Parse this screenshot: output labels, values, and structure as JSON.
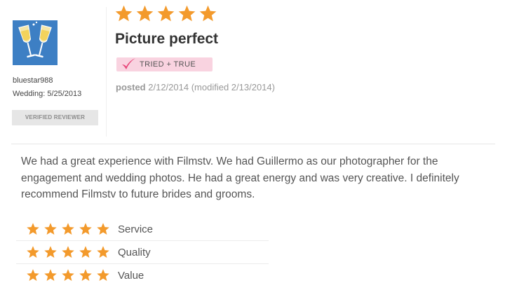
{
  "colors": {
    "star": "#f39a2c",
    "badge_pink": "#f9d3e0",
    "check_pink": "#e8467a",
    "avatar_blue": "#3d7fc4"
  },
  "reviewer": {
    "avatar_icon": "champagne-glasses-icon",
    "username": "bluestar988",
    "wedding_label": "Wedding:",
    "wedding_date": "5/25/2013",
    "verified_badge": "VERIFIED REVIEWER"
  },
  "review": {
    "overall_rating": 5,
    "overall_max": 5,
    "title": "Picture perfect",
    "badge_icon": "checkmark-icon",
    "badge_text": "TRIED + TRUE",
    "posted_label": "posted",
    "posted_date": "2/12/2014",
    "modified_text": "(modified 2/13/2014)",
    "body": "We had a great experience with Filmstv. We had Guillermo as our photographer for the engagement and wedding photos. He had a great energy and was very creative. I definitely recommend Filmstv to future brides and grooms."
  },
  "ratings": [
    {
      "label": "Service",
      "stars": 5,
      "max": 5
    },
    {
      "label": "Quality",
      "stars": 5,
      "max": 5
    },
    {
      "label": "Value",
      "stars": 5,
      "max": 5
    }
  ]
}
